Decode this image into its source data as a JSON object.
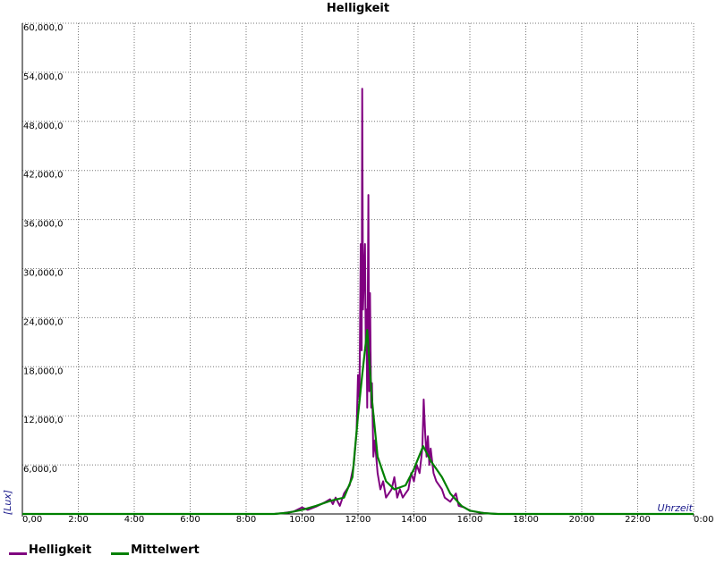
{
  "chart_data": {
    "type": "line",
    "title": "Helligkeit",
    "xlabel": "Uhrzeit",
    "ylabel": "[Lux]",
    "xlim": [
      0,
      24
    ],
    "ylim": [
      0,
      60000
    ],
    "x_ticks": [
      "0,00",
      "2:00",
      "4:00",
      "6:00",
      "8:00",
      "10:00",
      "12:00",
      "14:00",
      "16:00",
      "18:00",
      "20:00",
      "22:00",
      "0:00"
    ],
    "y_ticks": [
      "6,000,0",
      "12,000,0",
      "18,000,0",
      "24,000,0",
      "30,000,0",
      "36,000,0",
      "42,000,0",
      "48,000,0",
      "54,000,0",
      "60,000,0"
    ],
    "grid": true,
    "legend_position": "bottom-left",
    "series": [
      {
        "name": "Helligkeit",
        "color": "#800080",
        "points": [
          [
            0,
            0
          ],
          [
            9.0,
            0
          ],
          [
            9.3,
            100
          ],
          [
            9.7,
            300
          ],
          [
            10.0,
            800
          ],
          [
            10.2,
            500
          ],
          [
            10.5,
            900
          ],
          [
            10.8,
            1400
          ],
          [
            11.0,
            1800
          ],
          [
            11.1,
            1200
          ],
          [
            11.2,
            2000
          ],
          [
            11.35,
            1000
          ],
          [
            11.5,
            2500
          ],
          [
            11.7,
            3500
          ],
          [
            11.85,
            6000
          ],
          [
            11.95,
            10000
          ],
          [
            12.0,
            17000
          ],
          [
            12.05,
            14000
          ],
          [
            12.1,
            33000
          ],
          [
            12.13,
            20000
          ],
          [
            12.15,
            52000
          ],
          [
            12.18,
            25000
          ],
          [
            12.22,
            30000
          ],
          [
            12.25,
            33000
          ],
          [
            12.28,
            20000
          ],
          [
            12.3,
            25000
          ],
          [
            12.33,
            13000
          ],
          [
            12.37,
            39000
          ],
          [
            12.4,
            15000
          ],
          [
            12.43,
            27000
          ],
          [
            12.47,
            13000
          ],
          [
            12.5,
            16000
          ],
          [
            12.55,
            7000
          ],
          [
            12.6,
            9000
          ],
          [
            12.7,
            5000
          ],
          [
            12.8,
            3000
          ],
          [
            12.9,
            4000
          ],
          [
            13.0,
            2000
          ],
          [
            13.1,
            2500
          ],
          [
            13.2,
            3000
          ],
          [
            13.3,
            4500
          ],
          [
            13.4,
            2000
          ],
          [
            13.5,
            3000
          ],
          [
            13.6,
            2000
          ],
          [
            13.7,
            2500
          ],
          [
            13.8,
            3000
          ],
          [
            13.9,
            5000
          ],
          [
            14.0,
            4000
          ],
          [
            14.1,
            6000
          ],
          [
            14.2,
            5000
          ],
          [
            14.3,
            8000
          ],
          [
            14.35,
            14000
          ],
          [
            14.4,
            10000
          ],
          [
            14.45,
            7000
          ],
          [
            14.5,
            9500
          ],
          [
            14.55,
            6000
          ],
          [
            14.6,
            8000
          ],
          [
            14.7,
            5000
          ],
          [
            14.8,
            4000
          ],
          [
            15.0,
            3000
          ],
          [
            15.1,
            2000
          ],
          [
            15.3,
            1500
          ],
          [
            15.5,
            2500
          ],
          [
            15.6,
            1000
          ],
          [
            15.8,
            800
          ],
          [
            16.0,
            400
          ],
          [
            16.3,
            200
          ],
          [
            16.7,
            50
          ],
          [
            17.0,
            0
          ],
          [
            24,
            0
          ]
        ]
      },
      {
        "name": "Mittelwert",
        "color": "#008000",
        "points": [
          [
            0,
            0
          ],
          [
            9.0,
            0
          ],
          [
            9.5,
            150
          ],
          [
            10.0,
            500
          ],
          [
            10.5,
            1000
          ],
          [
            11.0,
            1600
          ],
          [
            11.5,
            2000
          ],
          [
            11.8,
            4500
          ],
          [
            12.0,
            12000
          ],
          [
            12.15,
            17000
          ],
          [
            12.33,
            22500
          ],
          [
            12.5,
            14000
          ],
          [
            12.7,
            7000
          ],
          [
            13.0,
            4000
          ],
          [
            13.3,
            3000
          ],
          [
            13.7,
            3500
          ],
          [
            14.0,
            5500
          ],
          [
            14.33,
            8300
          ],
          [
            14.6,
            6500
          ],
          [
            15.0,
            4500
          ],
          [
            15.3,
            2500
          ],
          [
            15.7,
            1000
          ],
          [
            16.0,
            400
          ],
          [
            16.5,
            100
          ],
          [
            17.0,
            0
          ],
          [
            24,
            0
          ]
        ]
      }
    ]
  }
}
